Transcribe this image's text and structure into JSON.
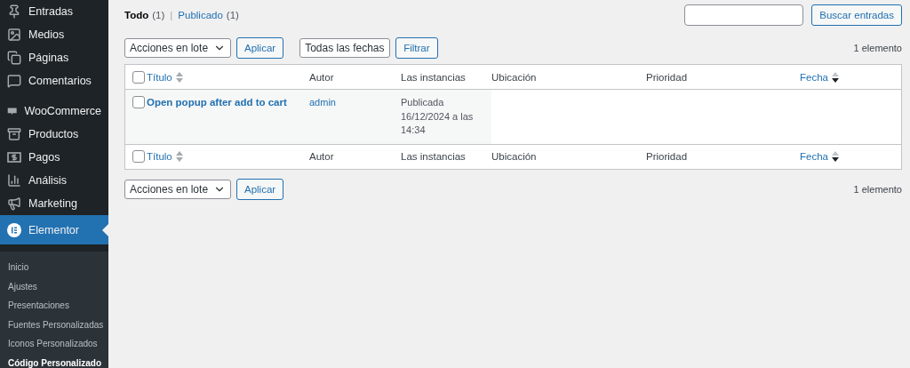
{
  "sidebar": {
    "groups": [
      [
        {
          "label": "Entradas",
          "selected": false
        },
        {
          "label": "Medios",
          "selected": false
        },
        {
          "label": "Páginas",
          "selected": false
        },
        {
          "label": "Comentarios",
          "selected": false
        }
      ],
      [
        {
          "label": "WooCommerce",
          "selected": false
        },
        {
          "label": "Productos",
          "selected": false
        },
        {
          "label": "Pagos",
          "selected": false
        },
        {
          "label": "Análisis",
          "selected": false
        },
        {
          "label": "Marketing",
          "selected": false
        },
        {
          "label": "Elementor",
          "selected": true
        }
      ]
    ],
    "submenu": [
      {
        "label": "Inicio",
        "selected": false
      },
      {
        "label": "Ajustes",
        "selected": false
      },
      {
        "label": "Presentaciones",
        "selected": false
      },
      {
        "label": "Fuentes Personalizadas",
        "selected": false
      },
      {
        "label": "Iconos Personalizados",
        "selected": false
      },
      {
        "label": "Código Personalizado",
        "selected": true
      }
    ]
  },
  "views": [
    {
      "label": "Todo",
      "count": "(1)",
      "selected": true
    },
    {
      "label": "Publicado",
      "count": "(1)",
      "selected": false
    }
  ],
  "views_separator": "|",
  "search": {
    "button": "Buscar entradas"
  },
  "top_actions": {
    "bulk": "Acciones en lote",
    "apply": "Aplicar",
    "dates": "Todas las fechas",
    "filter": "Filtrar",
    "count": "1 elemento"
  },
  "table": {
    "header": {
      "select_all_checked": false,
      "columns": [
        {
          "label": "Título",
          "sorted": false
        },
        {
          "label": "Autor"
        },
        {
          "label": "Las instancias"
        },
        {
          "label": "Ubicación"
        },
        {
          "label": "Prioridad"
        },
        {
          "label": "Fecha",
          "sorted": true
        }
      ]
    },
    "rows": [
      {
        "checked": false,
        "title": "Open popup after add to cart",
        "author": "admin",
        "instances": [
          "Publicada",
          "16/12/2024 a las",
          "14:34"
        ]
      }
    ],
    "footer": {
      "select_all_checked": false,
      "columns": [
        {
          "label": "Título",
          "sorted": false
        },
        {
          "label": "Autor"
        },
        {
          "label": "Las instancias"
        },
        {
          "label": "Ubicación"
        },
        {
          "label": "Prioridad"
        },
        {
          "label": "Fecha",
          "sorted": true
        }
      ]
    }
  },
  "bottom_actions": {
    "bulk": "Acciones en lote",
    "apply": "Aplicar",
    "count": "1 elemento"
  }
}
